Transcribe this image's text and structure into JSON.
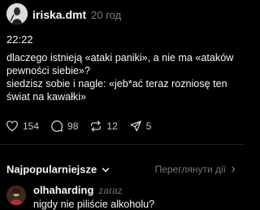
{
  "post": {
    "username": "iriska.dmt",
    "time_ago": "20 год",
    "time": "22:22",
    "text_line1": "dlaczego istnieją «ataki paniki», a nie ma «ataków pewności siebie»?",
    "text_line2": "siedzisz sobie i nagle: «jeb*ać teraz rozniosę ten świat na kawałki»"
  },
  "actions": {
    "likes": "154",
    "comments": "98",
    "reposts": "12",
    "shares": "5"
  },
  "replies_header": {
    "sort_label": "Najpopularniejsze",
    "view_activity": "Переглянути дії"
  },
  "comment": {
    "username": "olhaharding",
    "time_ago": "zaraz",
    "text": "nigdy nie piliście alkoholu?"
  },
  "icons": {
    "like": "heart-icon",
    "comment": "comment-bubble-icon",
    "repost": "repost-arrows-icon",
    "share": "send-paper-plane-icon",
    "sort": "chevron-down-icon",
    "view": "chevron-right-icon"
  },
  "colors": {
    "background": "#000000",
    "text": "#f5f5f5",
    "secondary": "#777777"
  }
}
